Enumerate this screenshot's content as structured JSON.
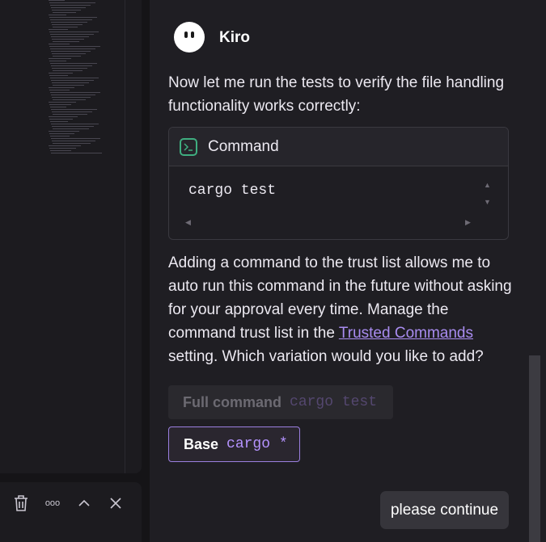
{
  "agent": {
    "name": "Kiro",
    "intro": "Now let me run the tests to verify the file handling functionality works correctly:"
  },
  "command_card": {
    "title": "Command",
    "code": "cargo test",
    "icon": "terminal-icon"
  },
  "trust_prompt": {
    "text_before": "Adding a command to the trust list allows me to auto run this command in the future without asking for your approval every time. Manage the command trust list in the ",
    "link": "Trusted Commands",
    "text_after": " setting. Which variation would you like to add?"
  },
  "options": {
    "full_label": "Full command",
    "full_value": "cargo test",
    "base_label": "Base",
    "base_value": "cargo *"
  },
  "user_message": "please continue",
  "bottom_toolbar": {
    "icons": [
      "trash-icon",
      "more-icon",
      "chevron-up-icon",
      "close-icon"
    ],
    "more_glyph": "ooo"
  },
  "colors": {
    "accent": "#9b7fe0",
    "link": "#a98cf0",
    "terminal_icon": "#3fae80"
  }
}
